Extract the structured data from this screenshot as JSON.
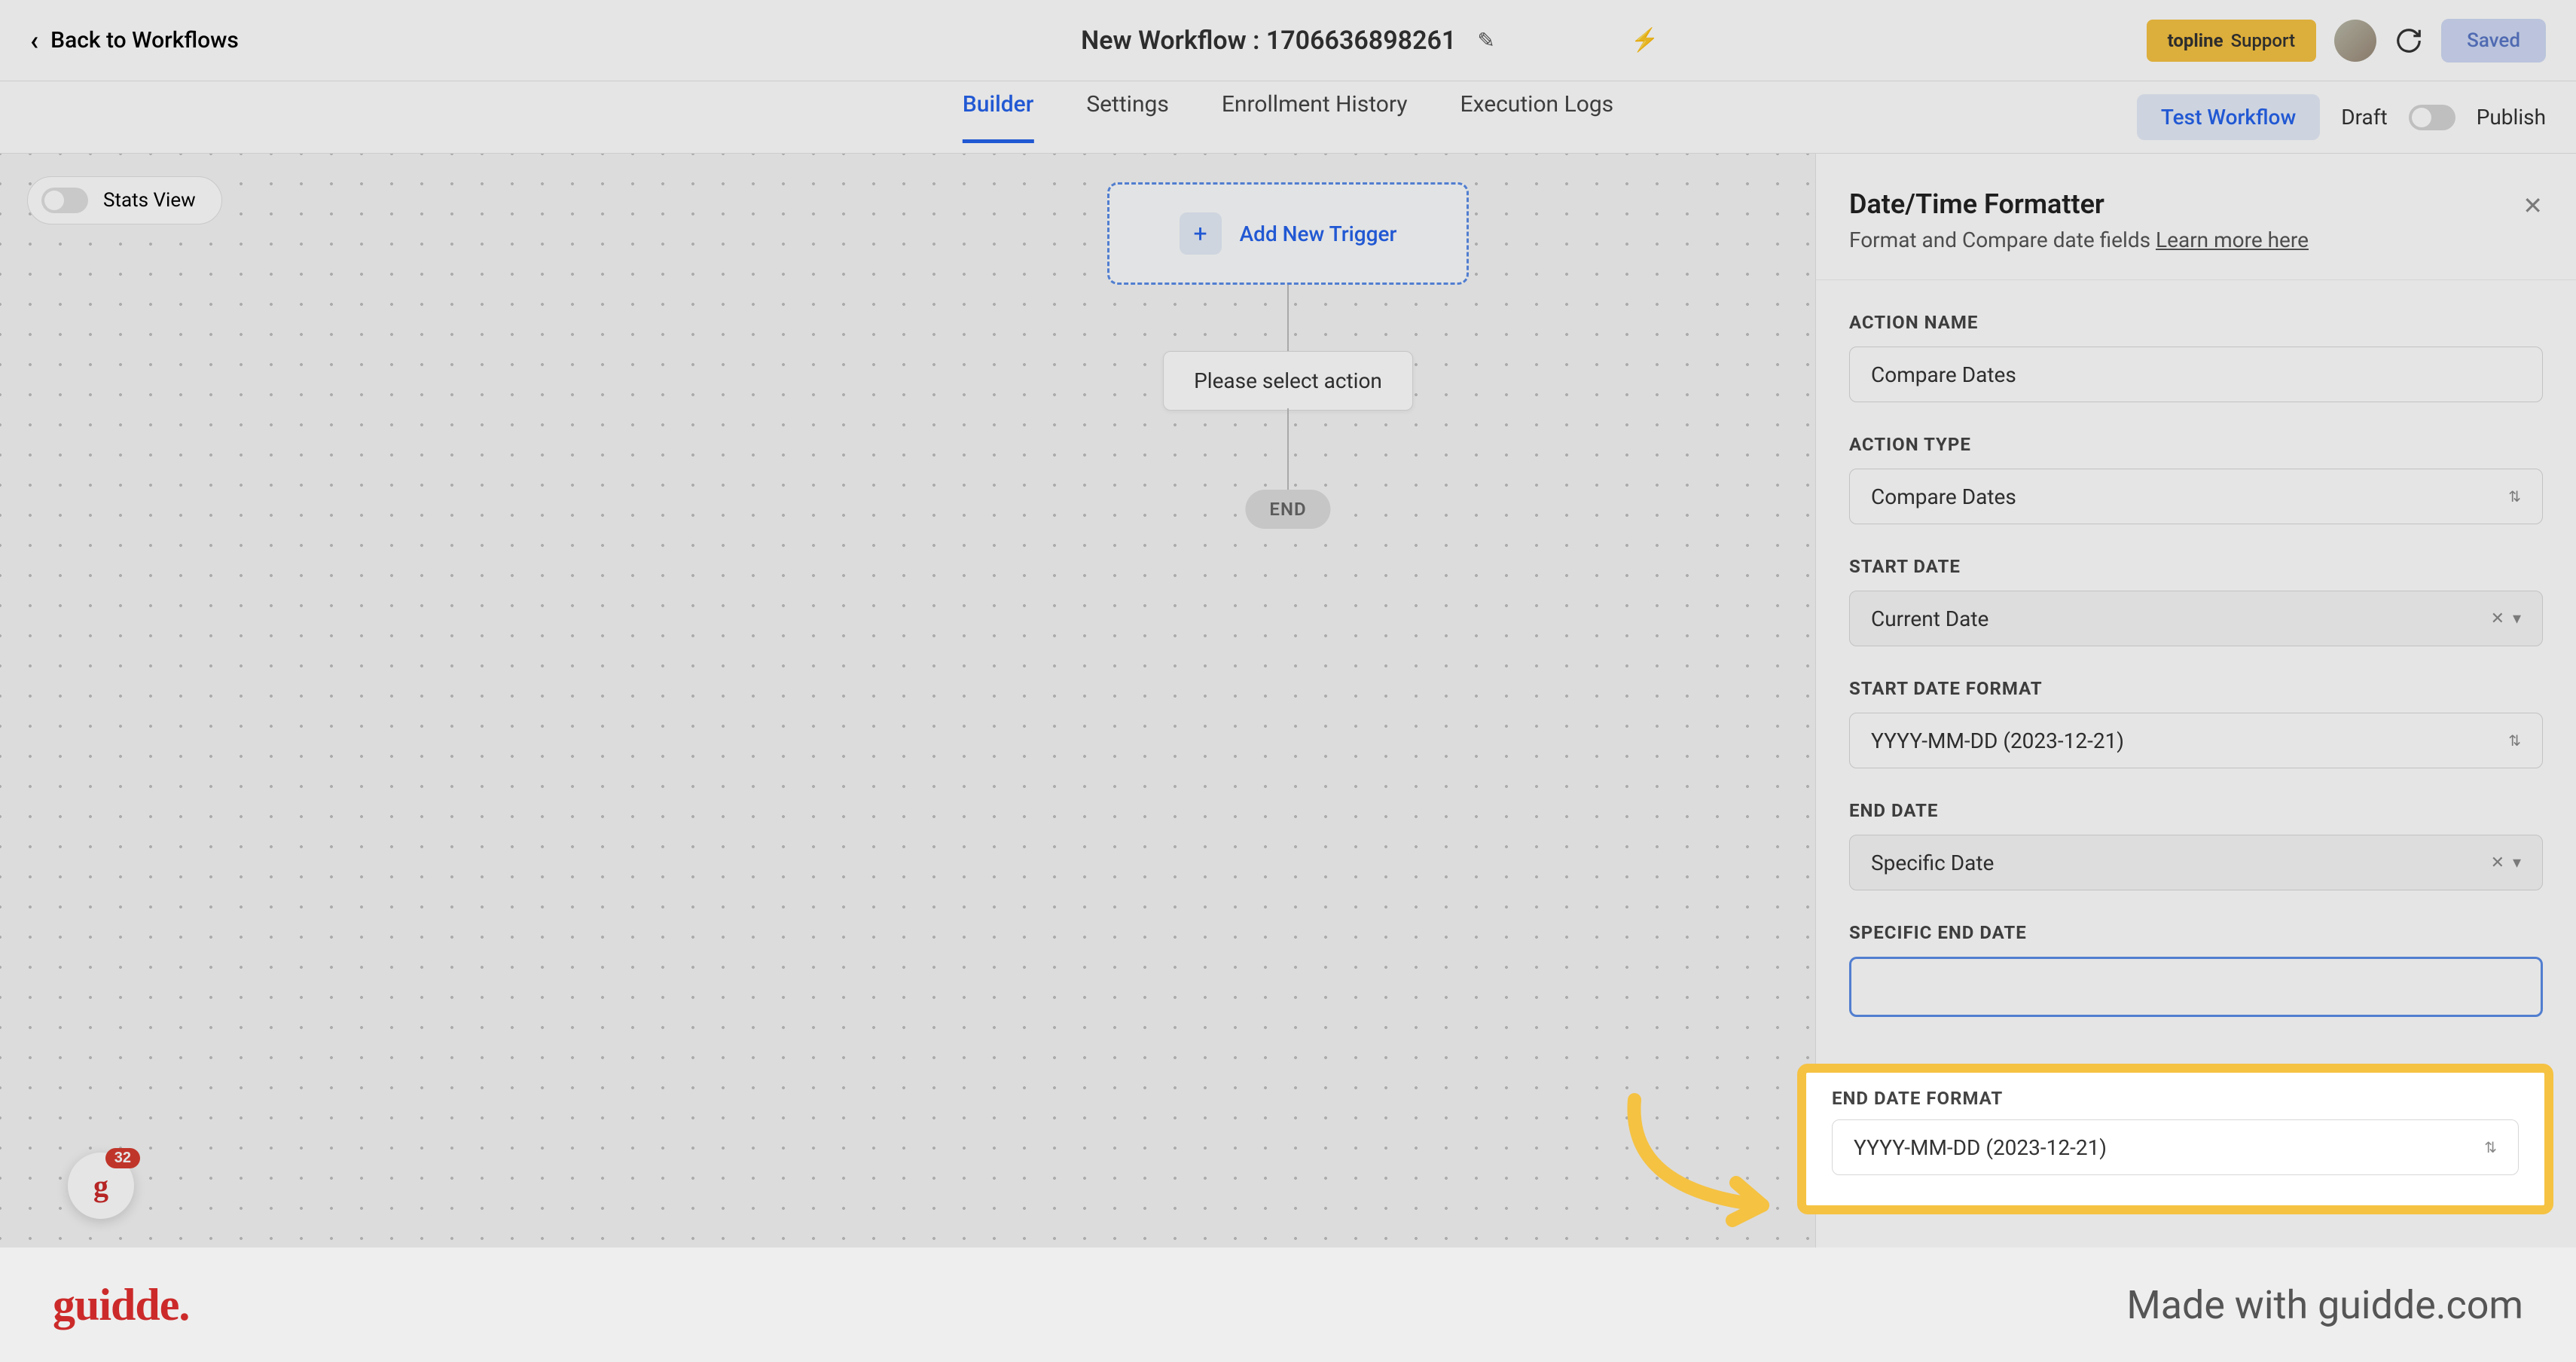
{
  "header": {
    "back_label": "Back to Workflows",
    "title": "New Workflow : 1706636898261",
    "support_prefix": "topline",
    "support_label": "Support",
    "saved_label": "Saved"
  },
  "tabs": {
    "builder": "Builder",
    "settings": "Settings",
    "enrollment": "Enrollment History",
    "execution": "Execution Logs",
    "test": "Test Workflow",
    "draft": "Draft",
    "publish": "Publish"
  },
  "canvas": {
    "stats_view": "Stats View",
    "add_trigger": "Add New Trigger",
    "select_action": "Please select action",
    "end": "END",
    "helper_badge": "32"
  },
  "panel": {
    "title": "Date/Time Formatter",
    "subtitle": "Format and Compare date fields ",
    "learn_more": "Learn more here",
    "action_name_label": "ACTION NAME",
    "action_name_value": "Compare Dates",
    "action_type_label": "ACTION TYPE",
    "action_type_value": "Compare Dates",
    "start_date_label": "START DATE",
    "start_date_value": "Current Date",
    "start_date_format_label": "START DATE FORMAT",
    "start_date_format_value": "YYYY-MM-DD (2023-12-21)",
    "end_date_label": "END DATE",
    "end_date_value": "Specific Date",
    "specific_end_date_label": "SPECIFIC END DATE",
    "specific_end_date_value": "",
    "end_date_format_label": "END DATE FORMAT",
    "end_date_format_value": "YYYY-MM-DD (2023-12-21)"
  },
  "footer": {
    "logo": "guidde.",
    "made_with": "Made with guidde.com"
  }
}
